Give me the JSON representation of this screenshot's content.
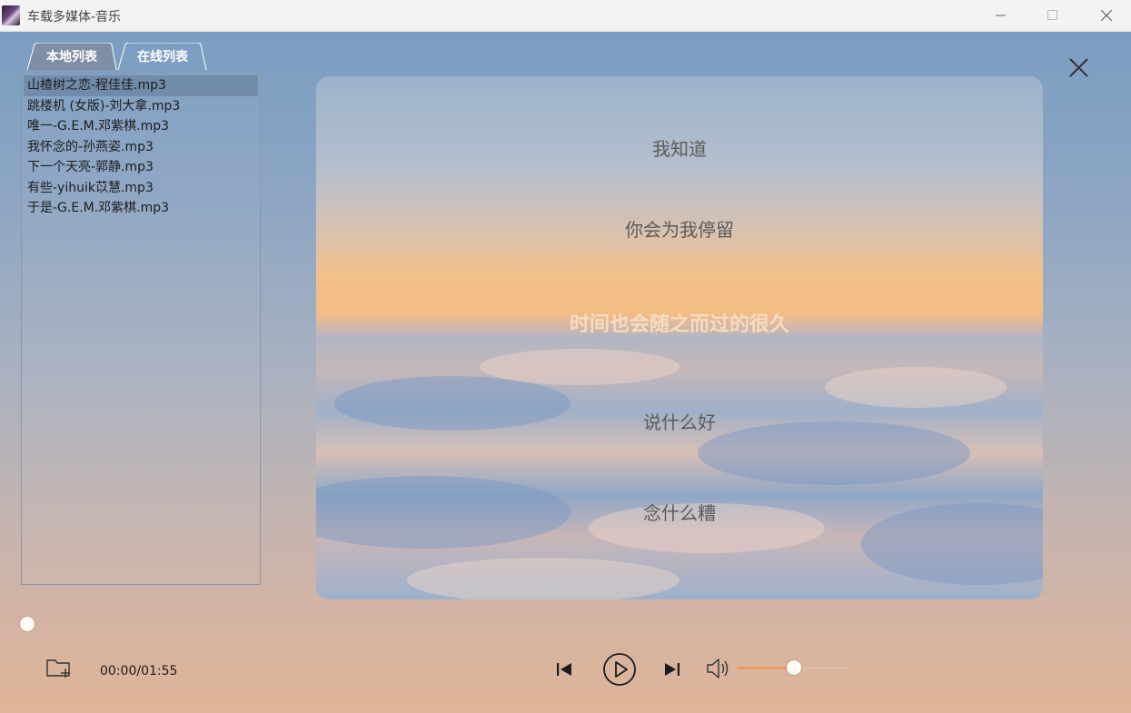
{
  "window": {
    "title": "车载多媒体-音乐",
    "minimize_icon": "minimize-icon",
    "maximize_icon": "maximize-icon",
    "close_icon": "close-icon"
  },
  "tabs": [
    {
      "label": "本地列表",
      "active": true
    },
    {
      "label": "在线列表",
      "active": false
    }
  ],
  "playlist": {
    "selected_index": 0,
    "items": [
      "山楂树之恋-程佳佳.mp3",
      "跳楼机 (女版)-刘大拿.mp3",
      "唯一-G.E.M.邓紫棋.mp3",
      "我怀念的-孙燕姿.mp3",
      "下一个天亮-郭静.mp3",
      "有些-yihuik苡慧.mp3",
      "于是-G.E.M.邓紫棋.mp3"
    ]
  },
  "lyrics": {
    "lines": [
      "我知道",
      "你会为我停留",
      "时间也会随之而过的很久",
      "说什么好",
      "念什么糟"
    ],
    "current_index": 2
  },
  "player": {
    "time_display": "00:00/01:55",
    "progress_fraction": 0,
    "volume_fraction": 0.5,
    "accent_color": "#ee9a62",
    "icons": [
      "folder-add-icon",
      "previous-icon",
      "play-icon",
      "next-icon",
      "volume-icon",
      "close-icon"
    ]
  }
}
